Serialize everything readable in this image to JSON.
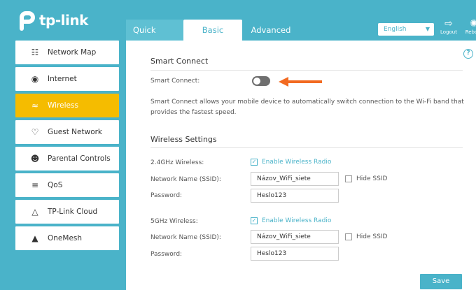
{
  "brand": {
    "name": "tp-link"
  },
  "tabs": {
    "quick_setup": "Quick Setup",
    "basic": "Basic",
    "advanced": "Advanced"
  },
  "header": {
    "language": "English",
    "logout": "Logout",
    "reboot": "Reboot"
  },
  "sidebar": {
    "items": [
      {
        "label": "Network Map",
        "icon": "network-map-icon"
      },
      {
        "label": "Internet",
        "icon": "globe-icon"
      },
      {
        "label": "Wireless",
        "icon": "wifi-icon"
      },
      {
        "label": "Guest Network",
        "icon": "guest-icon"
      },
      {
        "label": "Parental Controls",
        "icon": "parental-icon"
      },
      {
        "label": "QoS",
        "icon": "qos-icon"
      },
      {
        "label": "TP-Link Cloud",
        "icon": "cloud-icon"
      },
      {
        "label": "OneMesh",
        "icon": "onemesh-icon"
      }
    ],
    "active_index": 2
  },
  "smart_connect": {
    "title": "Smart Connect",
    "label": "Smart Connect:",
    "enabled": false,
    "description": "Smart Connect allows your mobile device to automatically switch connection to the Wi-Fi band that provides the fastest speed."
  },
  "wireless": {
    "title": "Wireless Settings",
    "band_24": {
      "label": "2.4GHz Wireless:",
      "enable_label": "Enable Wireless Radio",
      "ssid_label": "Network Name (SSID):",
      "ssid_value": "Názov_WiFi_siete",
      "hide_ssid_label": "Hide SSID",
      "password_label": "Password:",
      "password_value": "Heslo123"
    },
    "band_5": {
      "label": "5GHz Wireless:",
      "enable_label": "Enable Wireless Radio",
      "ssid_label": "Network Name (SSID):",
      "ssid_value": "Názov_WiFi_siete",
      "hide_ssid_label": "Hide SSID",
      "password_label": "Password:",
      "password_value": "Heslo123"
    }
  },
  "save_label": "Save",
  "colors": {
    "accent": "#4ab3c9",
    "active": "#f5bc00",
    "arrow": "#f26a21"
  }
}
